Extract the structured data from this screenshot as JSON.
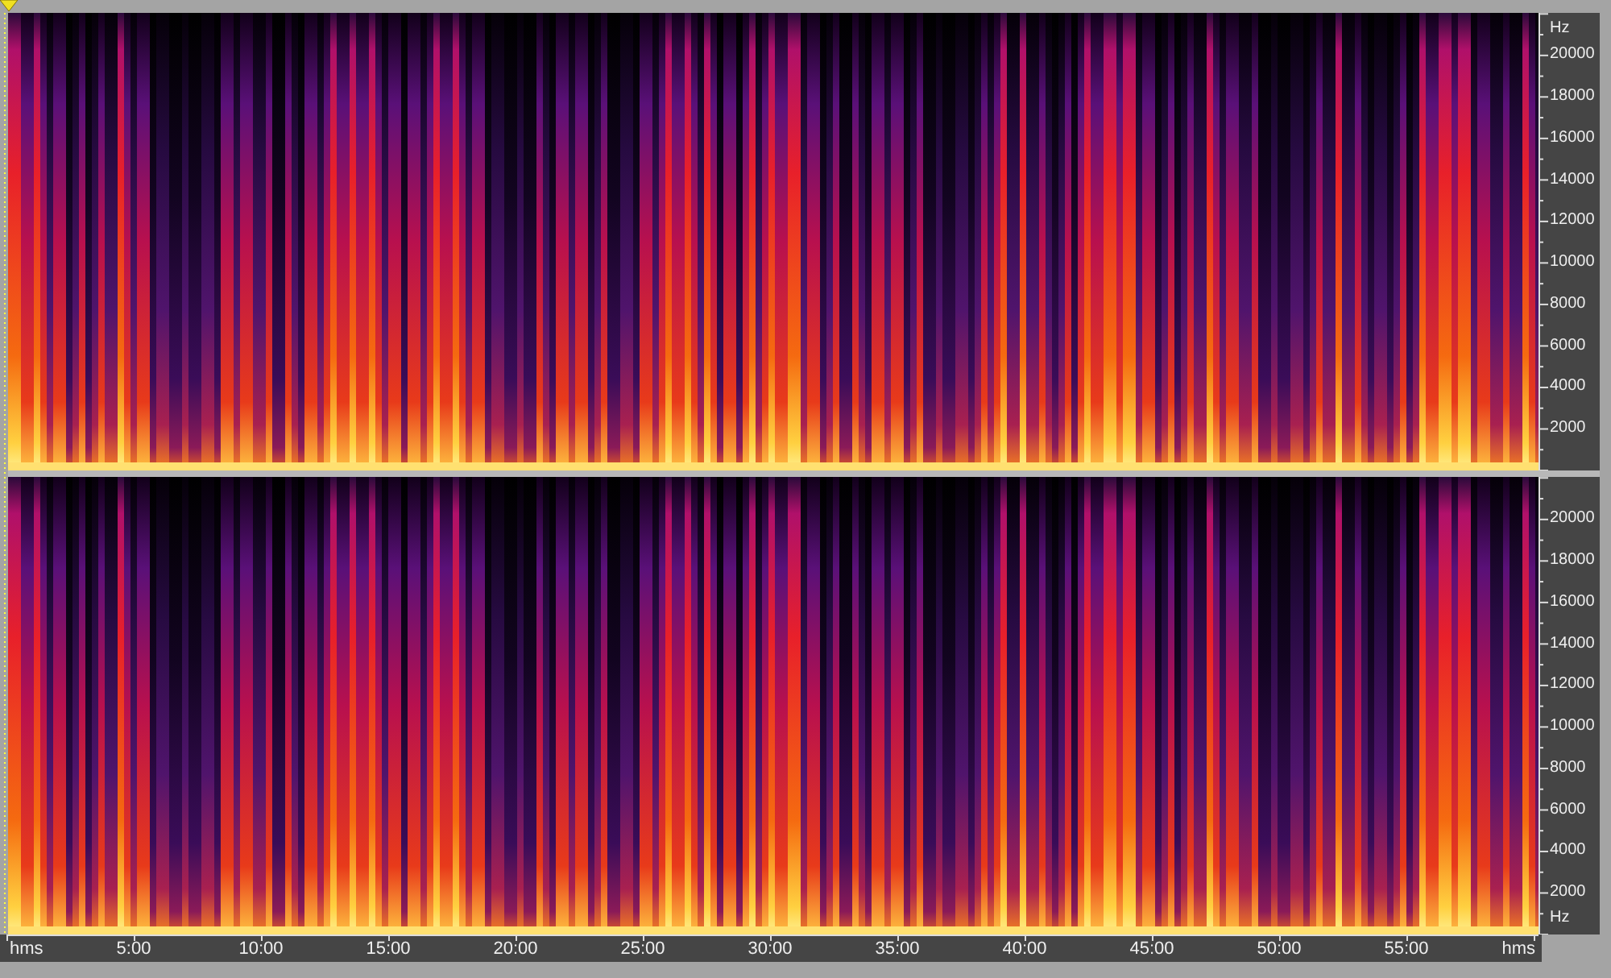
{
  "channels": [
    {
      "freq_labels": [
        {
          "kind": "unit",
          "text": "Hz"
        },
        {
          "kind": "tick",
          "text": "20000"
        },
        {
          "kind": "tick",
          "text": "18000"
        },
        {
          "kind": "tick",
          "text": "16000"
        },
        {
          "kind": "tick",
          "text": "14000"
        },
        {
          "kind": "tick",
          "text": "12000"
        },
        {
          "kind": "tick",
          "text": "10000"
        },
        {
          "kind": "tick",
          "text": "8000"
        },
        {
          "kind": "tick",
          "text": "6000"
        },
        {
          "kind": "tick",
          "text": "4000"
        },
        {
          "kind": "tick",
          "text": "2000"
        }
      ]
    },
    {
      "freq_labels": [
        {
          "kind": "tick",
          "text": "20000"
        },
        {
          "kind": "tick",
          "text": "18000"
        },
        {
          "kind": "tick",
          "text": "16000"
        },
        {
          "kind": "tick",
          "text": "14000"
        },
        {
          "kind": "tick",
          "text": "12000"
        },
        {
          "kind": "tick",
          "text": "10000"
        },
        {
          "kind": "tick",
          "text": "8000"
        },
        {
          "kind": "tick",
          "text": "6000"
        },
        {
          "kind": "tick",
          "text": "4000"
        },
        {
          "kind": "tick",
          "text": "2000"
        },
        {
          "kind": "unit",
          "text": "Hz"
        }
      ]
    }
  ],
  "time_ruler": {
    "labels": [
      {
        "kind": "unit",
        "text": "hms"
      },
      {
        "kind": "tick",
        "text": "5:00"
      },
      {
        "kind": "tick",
        "text": "10:00"
      },
      {
        "kind": "tick",
        "text": "15:00"
      },
      {
        "kind": "tick",
        "text": "20:00"
      },
      {
        "kind": "tick",
        "text": "25:00"
      },
      {
        "kind": "tick",
        "text": "30:00"
      },
      {
        "kind": "tick",
        "text": "35:00"
      },
      {
        "kind": "tick",
        "text": "40:00"
      },
      {
        "kind": "tick",
        "text": "45:00"
      },
      {
        "kind": "tick",
        "text": "50:00"
      },
      {
        "kind": "tick",
        "text": "55:00"
      },
      {
        "kind": "unit",
        "text": "hms"
      }
    ]
  }
}
